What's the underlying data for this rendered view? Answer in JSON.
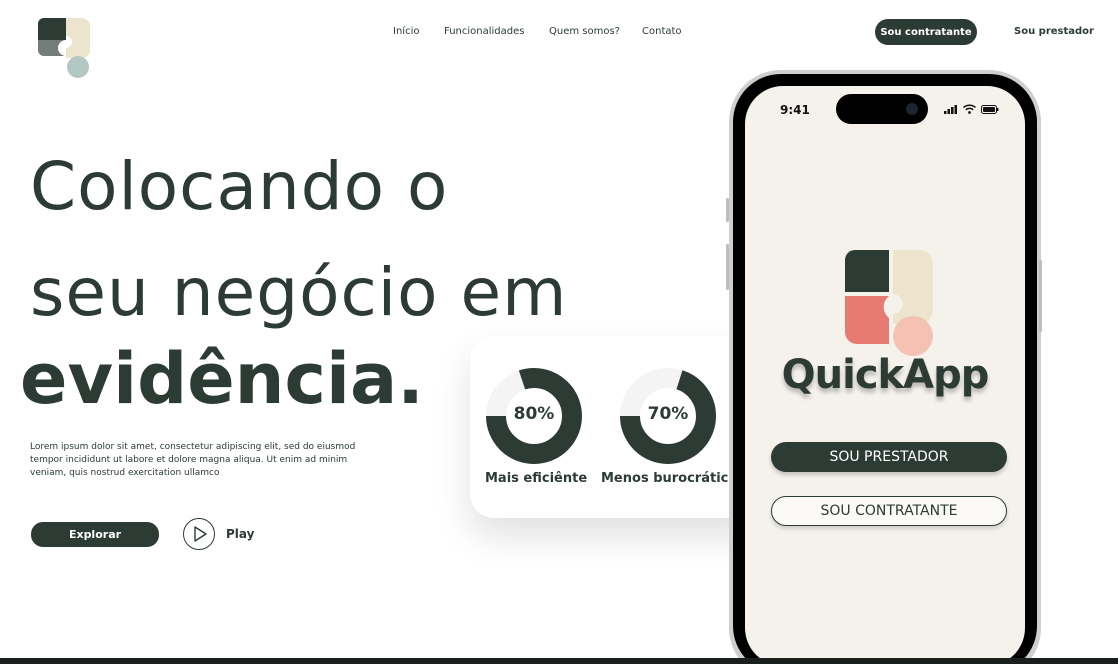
{
  "nav": {
    "items": [
      "Início",
      "Funcionalidades",
      "Quem somos?",
      "Contato"
    ],
    "cta_contratante": "Sou contratante",
    "prestador": "Sou prestador"
  },
  "hero": {
    "line1": "Colocando o",
    "line2": "seu negócio em",
    "line3": "evidência.",
    "description": "Lorem ipsum dolor sit amet, consectetur adipiscing elit, sed do eiusmod tempor incididunt ut labore et dolore magna aliqua. Ut enim ad minim veniam, quis nostrud exercitation ullamco",
    "explore_label": "Explorar",
    "play_label": "Play"
  },
  "stats": [
    {
      "value": "80%",
      "fraction": 0.8,
      "caption": "Mais eficiênte"
    },
    {
      "value": "70%",
      "fraction": 0.7,
      "caption": "Menos burocrático"
    }
  ],
  "phone": {
    "time": "9:41",
    "app_name": "QuickApp",
    "btn_prestador": "SOU PRESTADOR",
    "btn_contratante": "SOU CONTRATANTE"
  },
  "colors": {
    "primary": "#2d3b35",
    "donut_track": "#f4f4f4",
    "logo_cream": "#ece4cc",
    "logo_coral": "#e87a74",
    "logo_peach": "#f4c1b3",
    "logo_grey": "#757d78",
    "logo_mint": "#b3c7c3"
  }
}
